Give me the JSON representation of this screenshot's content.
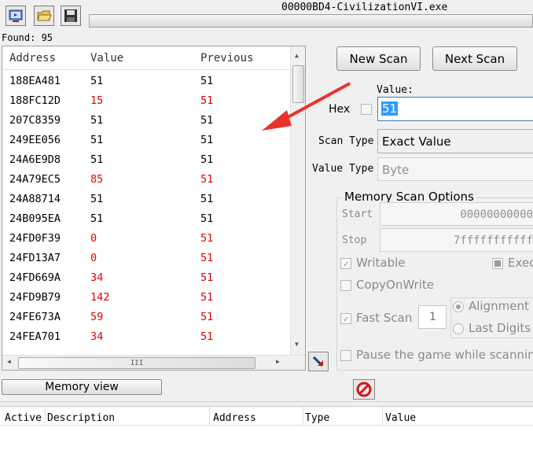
{
  "window": {
    "title": "00000BD4-CivilizationVI.exe"
  },
  "found": "Found: 95",
  "results": {
    "columns": [
      "Address",
      "Value",
      "Previous"
    ],
    "rows": [
      {
        "address": "188EA481",
        "value": "51",
        "previous": "51",
        "changed": false
      },
      {
        "address": "188FC12D",
        "value": "15",
        "previous": "51",
        "changed": true
      },
      {
        "address": "207C8359",
        "value": "51",
        "previous": "51",
        "changed": false
      },
      {
        "address": "249EE056",
        "value": "51",
        "previous": "51",
        "changed": false
      },
      {
        "address": "24A6E9D8",
        "value": "51",
        "previous": "51",
        "changed": false
      },
      {
        "address": "24A79EC5",
        "value": "85",
        "previous": "51",
        "changed": true
      },
      {
        "address": "24A88714",
        "value": "51",
        "previous": "51",
        "changed": false
      },
      {
        "address": "24B095EA",
        "value": "51",
        "previous": "51",
        "changed": false
      },
      {
        "address": "24FD0F39",
        "value": "0",
        "previous": "51",
        "changed": true
      },
      {
        "address": "24FD13A7",
        "value": "0",
        "previous": "51",
        "changed": true
      },
      {
        "address": "24FD669A",
        "value": "34",
        "previous": "51",
        "changed": true
      },
      {
        "address": "24FD9B79",
        "value": "142",
        "previous": "51",
        "changed": true
      },
      {
        "address": "24FE673A",
        "value": "59",
        "previous": "51",
        "changed": true
      },
      {
        "address": "24FEA701",
        "value": "34",
        "previous": "51",
        "changed": true
      }
    ],
    "hscroll_glyph": "III"
  },
  "buttons": {
    "new_scan": "New Scan",
    "next_scan": "Next Scan",
    "memory_view": "Memory view"
  },
  "scan": {
    "value_label": "Value:",
    "hex_label": "Hex",
    "value": "51",
    "scan_type_label": "Scan Type",
    "scan_type": "Exact Value",
    "value_type_label": "Value Type",
    "value_type": "Byte"
  },
  "options": {
    "title": "Memory Scan Options",
    "start_label": "Start",
    "start": "00000000000",
    "stop_label": "Stop",
    "stop": "7fffffffffff",
    "writable": "Writable",
    "executable": "Exec",
    "copy_on_write": "CopyOnWrite",
    "fast_scan": "Fast Scan",
    "fast_scan_value": "1",
    "alignment": "Alignment",
    "last_digits": "Last Digits",
    "pause": "Pause the game while scanning"
  },
  "address_list": {
    "columns": [
      "Active",
      "Description",
      "Address",
      "Type",
      "Value"
    ]
  },
  "colors": {
    "changed": "#e00000",
    "arrow": "#e8332c",
    "selection": "#3399ff"
  },
  "icons": [
    "open-process-icon",
    "open-file-icon",
    "save-icon",
    "add-address-icon",
    "stop-icon"
  ]
}
